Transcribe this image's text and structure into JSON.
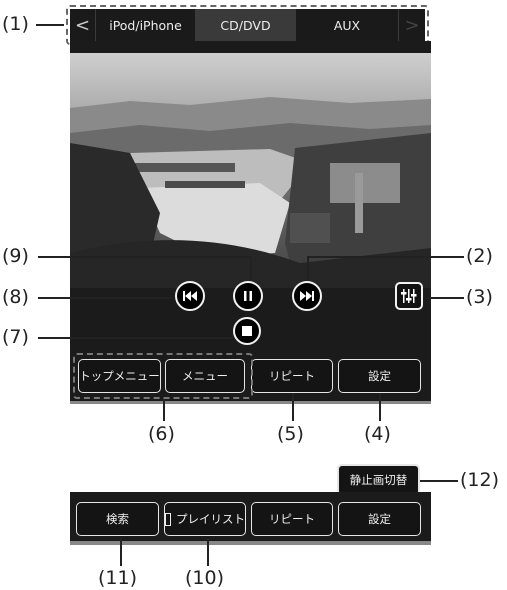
{
  "callouts": {
    "c1": "(1)",
    "c2": "(2)",
    "c3": "(3)",
    "c4": "(4)",
    "c5": "(5)",
    "c6": "(6)",
    "c7": "(7)",
    "c8": "(8)",
    "c9": "(9)",
    "c10": "(10)",
    "c11": "(11)",
    "c12": "(12)"
  },
  "tabs": {
    "prev": "<",
    "ipod": "iPod/iPhone",
    "cddvd": "CD/DVD",
    "aux": "AUX",
    "next": ">"
  },
  "buttons": {
    "top_menu": "トップメニュー",
    "menu": "メニュー",
    "repeat": "リピート",
    "settings": "設定",
    "still_switch": "静止画切替",
    "search": "検索",
    "playlist": "プレイリスト",
    "repeat2": "リピート",
    "settings2": "設定"
  },
  "icons": {
    "prev_track": "skip-previous-icon",
    "pause": "pause-icon",
    "next_track": "skip-next-icon",
    "stop": "stop-icon",
    "equalizer": "sound-settings-icon"
  }
}
